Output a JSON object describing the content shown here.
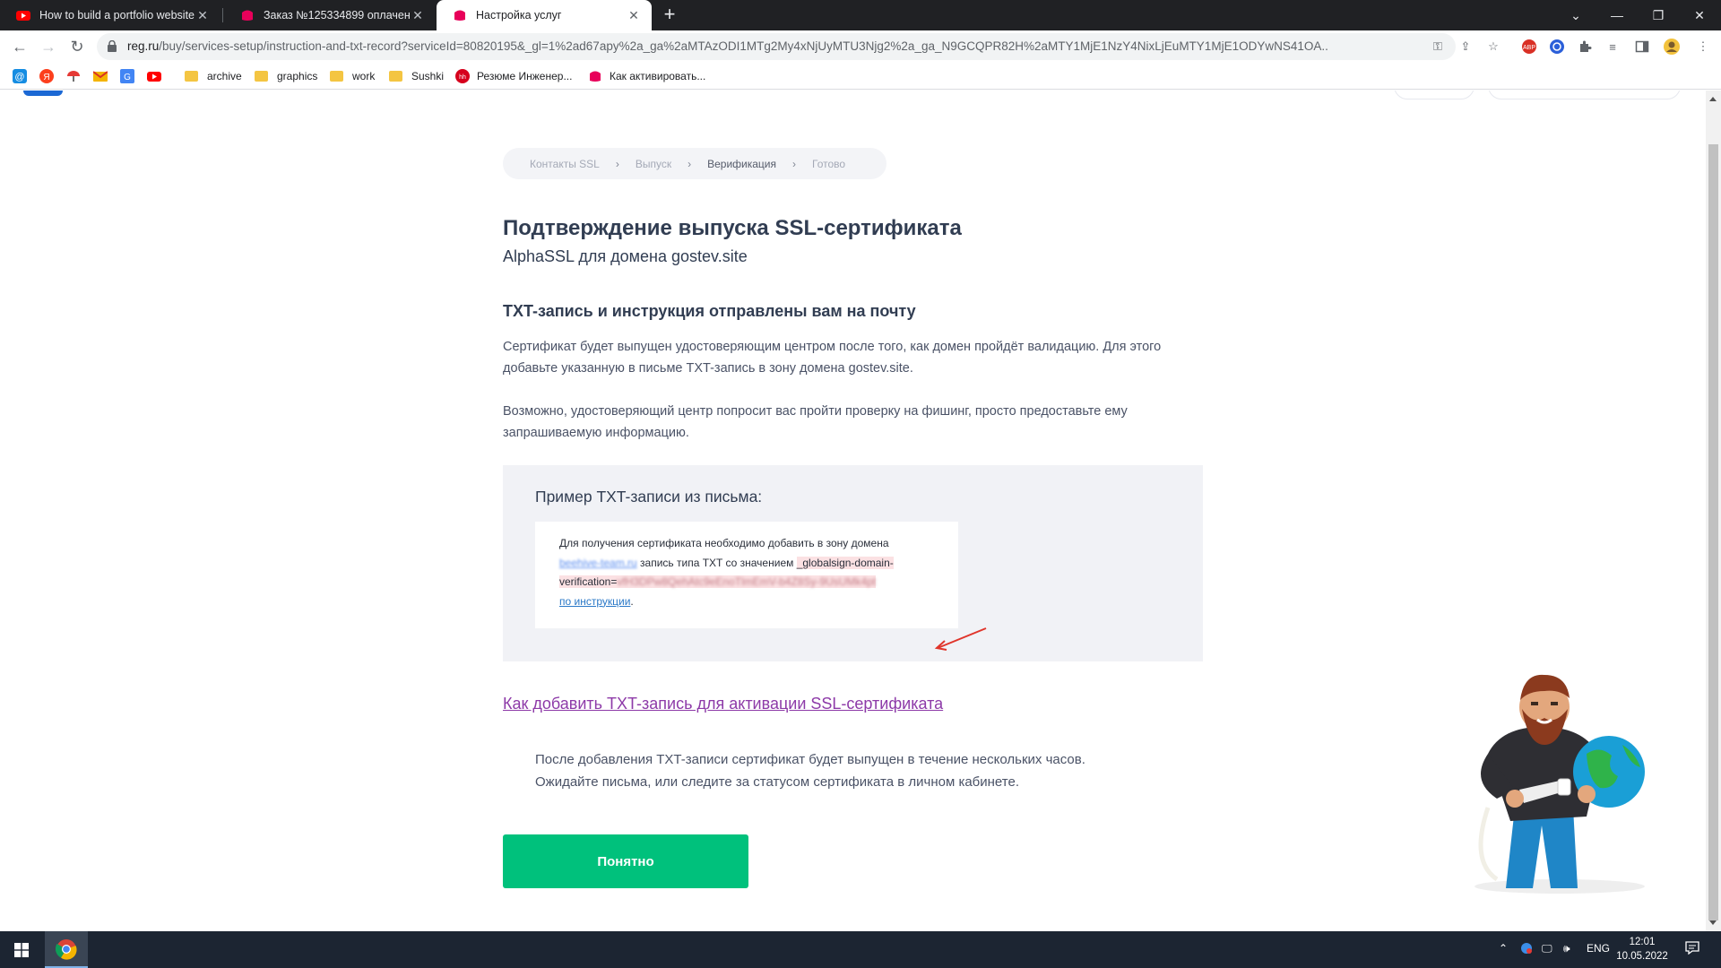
{
  "browser": {
    "tabs": [
      {
        "title": "How to build a portfolio website",
        "active": false
      },
      {
        "title": "Заказ №125334899 оплачен",
        "active": false
      },
      {
        "title": "Настройка услуг",
        "active": true
      }
    ],
    "new_tab": "+",
    "url_host": "reg.ru",
    "url_rest": "/buy/services-setup/instruction-and-txt-record?serviceId=80820195&_gl=1%2ad67apy%2a_ga%2aMTAzODI1MTg2My4xNjUyMTU3Njg2%2a_ga_N9GCQPR82H%2aMTY1MjE1NzY4NixLjEuMTY1MjE1ODYwNS41OA..",
    "bookmarks": [
      {
        "label": "",
        "icon": "mail-at-icon"
      },
      {
        "label": "",
        "icon": "yandex-icon"
      },
      {
        "label": "",
        "icon": "umbrella-icon"
      },
      {
        "label": "",
        "icon": "gmail-icon"
      },
      {
        "label": "",
        "icon": "translate-icon"
      },
      {
        "label": "",
        "icon": "youtube-icon"
      },
      {
        "label": "archive",
        "icon": "folder-icon"
      },
      {
        "label": "graphics",
        "icon": "folder-icon"
      },
      {
        "label": "work",
        "icon": "folder-icon"
      },
      {
        "label": "Sushki",
        "icon": "folder-icon"
      },
      {
        "label": "Резюме Инженер...",
        "icon": "hh-icon"
      },
      {
        "label": "Как активировать...",
        "icon": "regru-icon"
      }
    ],
    "extension_badge": "2"
  },
  "steps": [
    "Контакты SSL",
    "Выпуск",
    "Верификация",
    "Готово"
  ],
  "content": {
    "title": "Подтверждение выпуска SSL-сертификата",
    "subtitle": "AlphaSSL для домена gostev.site",
    "section_title": "TXT-запись и инструкция отправлены вам на почту",
    "para1_line1": "Сертификат будет выпущен удостоверяющим центром после того, как домен пройдёт валидацию. Для этого",
    "para1_line2": "добавьте указанную в письме TXT-запись в зону домена gostev.site.",
    "para2_line1": "Возможно, удостоверяющий центр попросит вас пройти проверку на фишинг, просто предоставьте ему",
    "para2_line2": "запрашиваемую информацию.",
    "example_title": "Пример TXT-записи из письма:",
    "mail": {
      "line1": "Для получения сертификата необходимо добавить в зону домена",
      "domain_blurred": "beehive-team.ru",
      "mid": " запись типа TXT со значением ",
      "value_prefix": "_globalsign-domain-",
      "value_prefix2": "verification=",
      "value_blurred": "vfH3DPw8QehAtc9eEnoTlmEmV-b4Z8Sy-9UsUMk4pt",
      "link": "по инструкции",
      "end": "."
    },
    "howto_link": "Как добавить TXT-запись для активации SSL-сертификата",
    "after_line1": "После добавления TXT-записи сертификат будет выпущен в течение нескольких часов.",
    "after_line2": "Ожидайте письма, или следите за статусом сертификата в личном кабинете.",
    "ok_button": "Понятно"
  },
  "taskbar": {
    "lang": "ENG",
    "time": "12:01",
    "date": "10.05.2022"
  },
  "colors": {
    "accent_green": "#00c17c",
    "text_dark": "#313d52",
    "link_purple": "#8d3aa8"
  }
}
